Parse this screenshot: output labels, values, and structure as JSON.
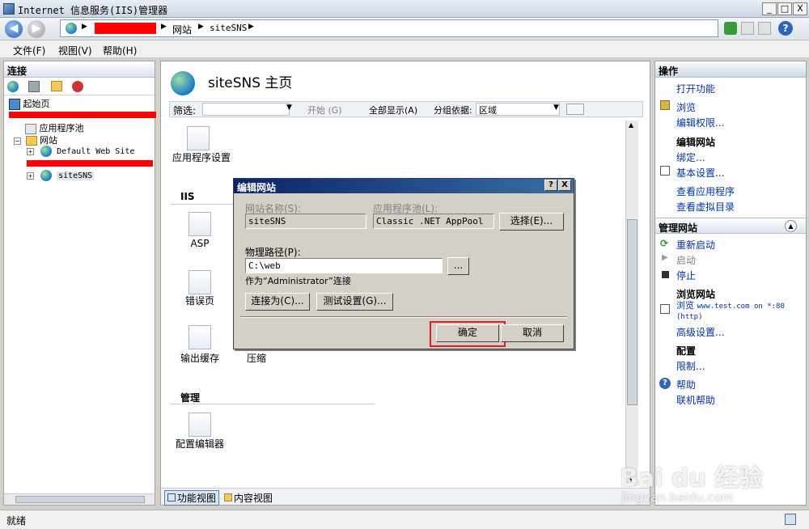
{
  "window": {
    "title": "Internet 信息服务(IIS)管理器",
    "min_label": "_",
    "max_label": "□",
    "close_label": "X"
  },
  "address": {
    "crumbs": [
      "网站",
      "siteSNS"
    ],
    "help_label": "?"
  },
  "menu": [
    "文件(F)",
    "视图(V)",
    "帮助(H)"
  ],
  "connections": {
    "title": "连接",
    "tree": {
      "start_page": "起始页",
      "app_pools": "应用程序池",
      "sites": "网站",
      "default_site": "Default Web Site",
      "site_sns": "siteSNS"
    }
  },
  "center": {
    "title": "siteSNS 主页",
    "filter_label": "筛选:",
    "start_label": "开始 (G)",
    "show_all_label": "全部显示(A)",
    "group_by_label": "分组依据:",
    "group_value": "区域",
    "sections": {
      "iis": "IIS",
      "manage": "管理"
    },
    "features": {
      "app_settings": "应用程序设置",
      "asp": "ASP",
      "error_pages": "错误页",
      "output_cache": "输出缓存",
      "compress": "压缩",
      "config_editor": "配置编辑器"
    },
    "tabs": {
      "features_view": "功能视图",
      "content_view": "内容视图"
    }
  },
  "dialog": {
    "title": "编辑网站",
    "site_name_label": "网站名称(S):",
    "site_name_value": "siteSNS",
    "app_pool_label": "应用程序池(L):",
    "app_pool_value": "Classic .NET AppPool",
    "select_button": "选择(E)...",
    "physical_path_label": "物理路径(P):",
    "physical_path_value": "C:\\web",
    "browse_button": "...",
    "connect_as_text": "作为“Administrator”连接",
    "connect_as_button": "连接为(C)...",
    "test_settings_button": "测试设置(G)...",
    "ok_button": "确定",
    "cancel_button": "取消",
    "help_button": "?",
    "close_button": "X"
  },
  "actions": {
    "title": "操作",
    "open_feature": "打开功能",
    "browse": "浏览",
    "edit_permissions": "编辑权限...",
    "edit_site_header": "编辑网站",
    "bindings": "绑定...",
    "basic_settings": "基本设置...",
    "view_apps": "查看应用程序",
    "view_vdirs": "查看虚拟目录",
    "manage_site_header": "管理网站",
    "restart": "重新启动",
    "start": "启动",
    "stop": "停止",
    "browse_site_header": "浏览网站",
    "browse_url_prefix": "浏览",
    "browse_url": "www.test.com on *:80",
    "browse_url_proto": "(http)",
    "advanced_settings": "高级设置...",
    "config_header": "配置",
    "limits": "限制...",
    "help": "帮助",
    "online_help": "联机帮助"
  },
  "status": {
    "text": "就绪"
  },
  "watermark": {
    "brand": "Bai du 经验",
    "url": "jingyan.baidu.com"
  },
  "colors": {
    "highlight_red": "#ff0000",
    "dialog_title": "#0a246a",
    "link": "#0033aa"
  }
}
